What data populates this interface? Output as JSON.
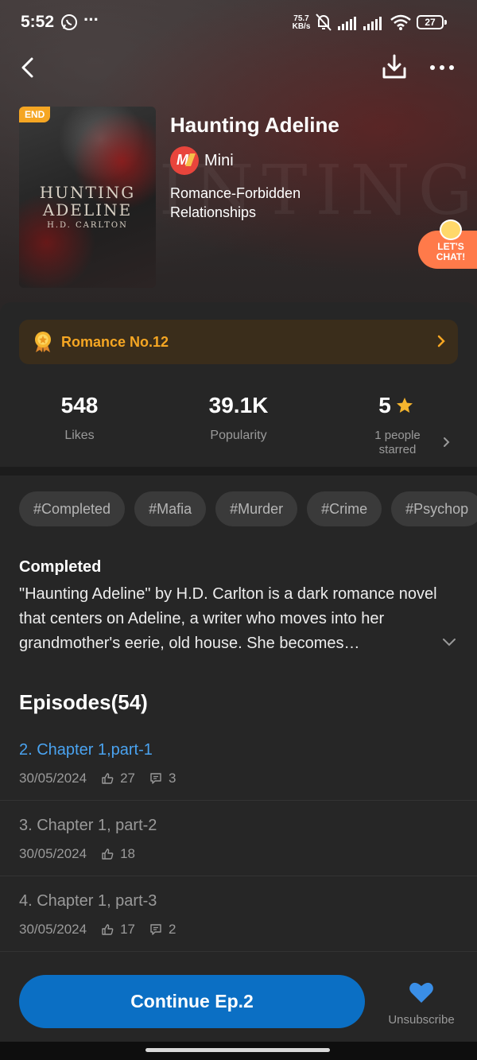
{
  "status_bar": {
    "time": "5:52",
    "more": "···",
    "net_speed_value": "75.7",
    "net_speed_unit": "KB/s",
    "battery": "27"
  },
  "book": {
    "badge": "END",
    "cover_title_line1": "HUNTING",
    "cover_title_line2": "ADELINE",
    "cover_author": "H.D. CARLTON",
    "title": "Haunting Adeline",
    "author_logo_text": "M",
    "author": "Mini",
    "genre": "Romance-Forbidden Relationships"
  },
  "chat": {
    "label_line1": "LET'S",
    "label_line2": "CHAT!"
  },
  "ranking": {
    "label": "Romance No.12"
  },
  "stats": {
    "likes_value": "548",
    "likes_label": "Likes",
    "popularity_value": "39.1K",
    "popularity_label": "Popularity",
    "rating_value": "5",
    "starred_label": "1 people starred"
  },
  "tags": [
    "#Completed",
    "#Mafia",
    "#Murder",
    "#Crime",
    "#Psychop"
  ],
  "description": {
    "status": "Completed",
    "text": "\"Haunting Adeline\" by H.D. Carlton is a dark romance novel that centers on Adeline, a writer who moves into her grandmother's eerie, old house. She becomes…"
  },
  "episodes": {
    "heading": "Episodes(54)",
    "items": [
      {
        "title": "2. Chapter 1,part-1",
        "date": "30/05/2024",
        "likes": "27",
        "comments": "3"
      },
      {
        "title": "3. Chapter 1, part-2",
        "date": "30/05/2024",
        "likes": "18"
      },
      {
        "title": "4. Chapter 1, part-3",
        "date": "30/05/2024",
        "likes": "17",
        "comments": "2"
      }
    ]
  },
  "actions": {
    "continue_label": "Continue Ep.2",
    "unsubscribe_label": "Unsubscribe"
  },
  "colors": {
    "accent_blue": "#0b6fc4",
    "link_blue": "#4aa3f0",
    "rank_orange": "#f5a623",
    "heart_blue": "#3a8ee6",
    "background": "#262626"
  },
  "icons": [
    "back-icon",
    "download-icon",
    "more-icon",
    "medal-icon",
    "star-icon",
    "chevron-right-icon",
    "chevron-down-icon",
    "thumbs-up-icon",
    "comment-icon",
    "heart-icon",
    "whatsapp-icon",
    "mute-icon",
    "signal-icon",
    "wifi-icon",
    "battery-icon"
  ]
}
